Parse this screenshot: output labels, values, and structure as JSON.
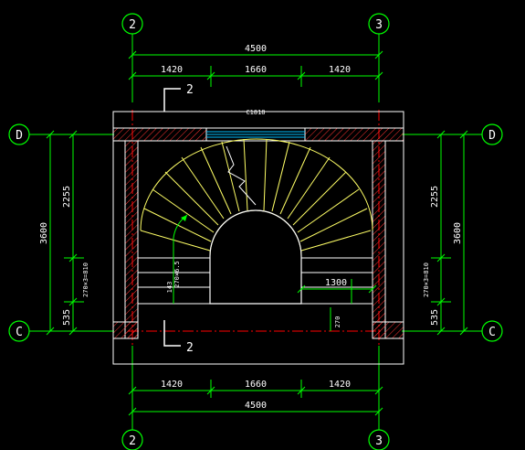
{
  "axes": {
    "top_left": "2",
    "top_right": "3",
    "bottom_left": "2",
    "bottom_right": "3",
    "left_top": "D",
    "left_bottom": "C",
    "right_top": "D",
    "right_bottom": "C"
  },
  "dims": {
    "top_total": "4500",
    "top_seg1": "1420",
    "top_seg2": "1660",
    "top_seg3": "1420",
    "bottom_total": "4500",
    "bottom_seg1": "1420",
    "bottom_seg2": "1660",
    "bottom_seg3": "1420",
    "left_total": "3600",
    "left_upper": "2255",
    "left_mid": "270×3=810",
    "left_lower": "535",
    "right_total": "3600",
    "right_upper": "2255",
    "right_mid": "270×3=810",
    "right_lower": "535",
    "inner_width": "1300",
    "inner_270": "270"
  },
  "labels": {
    "section_top": "2",
    "section_bottom": "2",
    "window": "C1818",
    "stair_note_1": "270×6.5",
    "stair_note_2": "143"
  },
  "colors": {
    "dim": "#00ff00",
    "wall": "#ffffff",
    "stair": "#ffff66",
    "axis": "#ff0000",
    "hatch": "#ff3333",
    "window": "#00c0ff"
  }
}
